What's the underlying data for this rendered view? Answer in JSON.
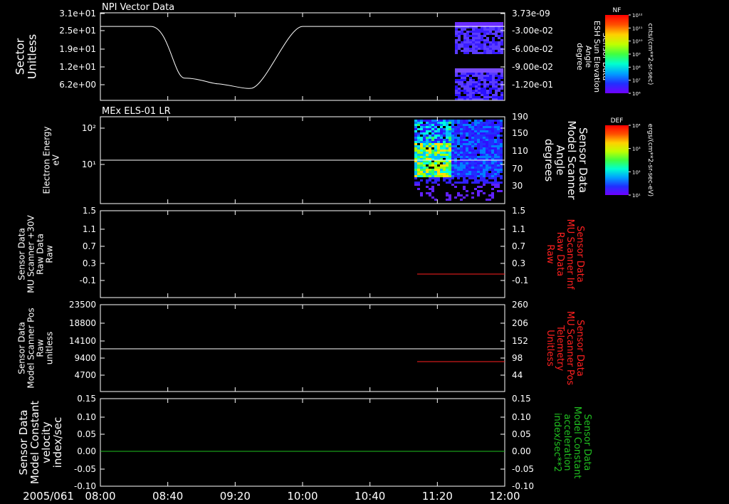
{
  "figure": {
    "date_label": "2005/061",
    "x_ticks": [
      "08:00",
      "08:40",
      "09:20",
      "10:00",
      "10:40",
      "11:20",
      "12:00"
    ]
  },
  "colorbars": {
    "nf": {
      "label": "NF",
      "unit": "cnts/(cm**2-sr-sec)",
      "ticks": [
        "10¹²",
        "10¹¹",
        "10¹⁰",
        "10⁹",
        "10⁸",
        "10⁷",
        "10⁶"
      ]
    },
    "def": {
      "label": "DEF",
      "unit": "ergs/(cm**2-sr-sec-eV)",
      "ticks": [
        "10⁴",
        "10³",
        "10²",
        "10¹"
      ]
    }
  },
  "colors": {
    "white": "#ffffff",
    "red": "#ff2020",
    "green": "#20c020",
    "frame": "#ffffff"
  },
  "chart_data": [
    {
      "type": "line",
      "title": "NPI Vector Data",
      "ylabel": [
        "Sector",
        "Unitless"
      ],
      "yticks": [
        "3.1e+01",
        "2.5e+01",
        "1.9e+01",
        "1.2e+01",
        "6.2e+00"
      ],
      "right_ylabel": [
        "Sensor Data",
        "ESH Sun Elevation",
        "Angle",
        "degree"
      ],
      "right_yticks": [
        "3.73e-09",
        "-3.00e-02",
        "-6.00e-02",
        "-9.00e-02",
        "-1.20e-01"
      ],
      "series": [
        {
          "x": [
            "08:00",
            "08:30",
            "08:50",
            "09:10",
            "09:30",
            "09:40",
            "10:00",
            "12:00"
          ],
          "y": [
            26.5,
            26.5,
            8.5,
            6.5,
            5.0,
            7.5,
            26.5,
            26.5
          ]
        }
      ]
    },
    {
      "type": "heatmap",
      "title": "MEx ELS-01 LR",
      "ylabel": [
        "Electron Energy",
        "eV"
      ],
      "yticks": [
        "10²",
        "10¹"
      ],
      "right_ylabel": [
        "Sensor Data",
        "Model Scanner",
        "Angle",
        "degrees"
      ],
      "right_yticks": [
        "190",
        "150",
        "110",
        "70",
        "30"
      ],
      "series": [
        {
          "x": [
            "08:00",
            "12:00"
          ],
          "y": [
            100,
            100
          ]
        }
      ]
    },
    {
      "type": "line",
      "ylabel": [
        "Sensor Data",
        "MU Scanner +30V",
        "Raw Data",
        "Raw"
      ],
      "yticks": [
        "1.5",
        "1.1",
        "0.7",
        "0.3",
        "-0.1"
      ],
      "right_ylabel": [
        "Sensor Data",
        "MU Scanner Inf",
        "Raw Data",
        "Raw"
      ],
      "right_yticks": [
        "1.5",
        "1.1",
        "0.7",
        "0.3",
        "-0.1"
      ],
      "series": [
        {
          "x": [
            "11:08",
            "12:00"
          ],
          "y": [
            0.0,
            0.0
          ]
        }
      ]
    },
    {
      "type": "line",
      "ylabel": [
        "Sensor Data",
        "Model Scanner Pos",
        "Raw",
        "unitless"
      ],
      "yticks": [
        "23500",
        "18800",
        "14100",
        "9400",
        "4700"
      ],
      "right_ylabel": [
        "Sensor Data",
        "MU Scanner Pos",
        "Telemetry",
        "Unitless"
      ],
      "right_yticks": [
        "260",
        "206",
        "152",
        "98",
        "44"
      ],
      "series": [
        {
          "x": [
            "08:00",
            "12:00"
          ],
          "y": [
            11600,
            11600
          ]
        },
        {
          "x": [
            "11:08",
            "12:00"
          ],
          "y": [
            80,
            80
          ]
        }
      ]
    },
    {
      "type": "line",
      "ylabel": [
        "Sensor Data",
        "Model Constant",
        "velocity",
        "index/sec"
      ],
      "yticks": [
        "0.15",
        "0.10",
        "0.05",
        "0.00",
        "-0.05",
        "-0.10"
      ],
      "right_ylabel": [
        "Sensor Data",
        "Model Constant",
        "acceleration",
        "index/sec**2"
      ],
      "right_yticks": [
        "0.15",
        "0.10",
        "0.05",
        "0.00",
        "-0.05",
        "-0.10"
      ],
      "series": [
        {
          "x": [
            "08:00",
            "12:00"
          ],
          "y": [
            0.0,
            0.0
          ]
        }
      ]
    }
  ]
}
